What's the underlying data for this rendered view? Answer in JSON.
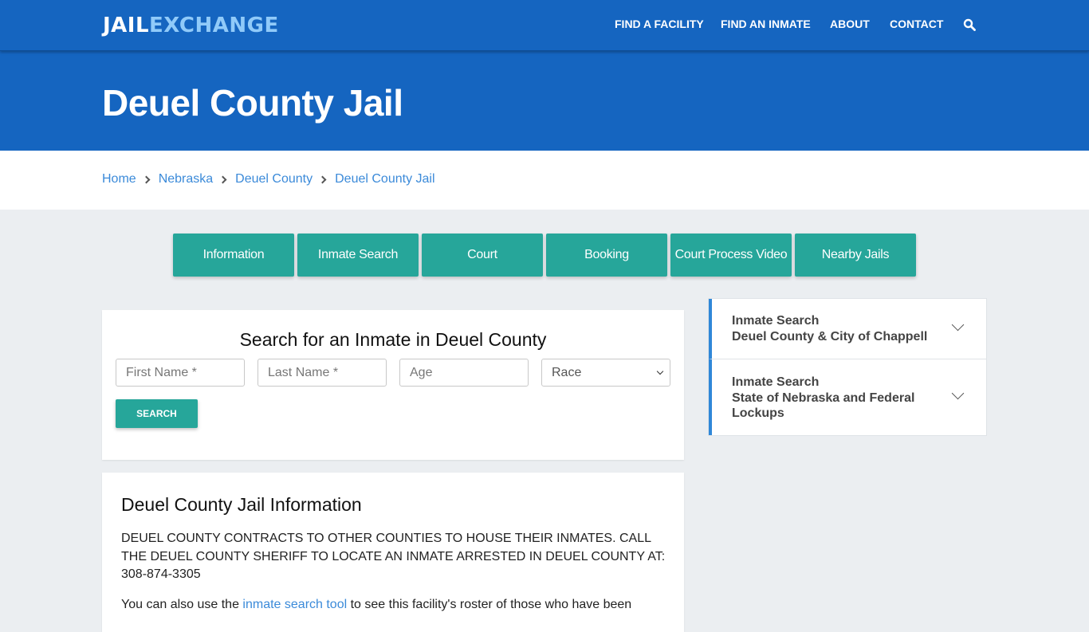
{
  "header": {
    "logo_part1": "JAIL",
    "logo_part2": "EXCHANGE",
    "nav": [
      {
        "label": "FIND A FACILITY"
      },
      {
        "label": "FIND AN INMATE"
      },
      {
        "label": "ABOUT"
      },
      {
        "label": "CONTACT"
      }
    ],
    "search_icon": "search-icon"
  },
  "hero": {
    "title": "Deuel County Jail"
  },
  "breadcrumb": [
    {
      "label": "Home"
    },
    {
      "label": "Nebraska"
    },
    {
      "label": "Deuel County"
    },
    {
      "label": "Deuel County Jail"
    }
  ],
  "tabs": [
    {
      "label": "Information"
    },
    {
      "label": "Inmate Search"
    },
    {
      "label": "Court"
    },
    {
      "label": "Booking"
    },
    {
      "label": "Court Process Video"
    },
    {
      "label": "Nearby Jails"
    }
  ],
  "search_form": {
    "title": "Search for an Inmate in Deuel County",
    "first_name_placeholder": "First Name *",
    "last_name_placeholder": "Last Name *",
    "age_placeholder": "Age",
    "race_selected": "Race",
    "submit_label": "SEARCH"
  },
  "info": {
    "title": "Deuel County Jail Information",
    "paragraph1": "DEUEL COUNTY CONTRACTS TO OTHER COUNTIES TO HOUSE THEIR INMATES.  CALL THE DEUEL COUNTY SHERIFF TO LOCATE AN INMATE ARRESTED IN DEUEL COUNTY AT: 308-874-3305",
    "paragraph2_before": "You can also use the ",
    "paragraph2_link": "inmate search tool",
    "paragraph2_after": " to see this facility's roster of those who have been"
  },
  "sidebar": {
    "items": [
      {
        "line1": "Inmate Search",
        "line2": "Deuel County & City of Chappell"
      },
      {
        "line1": "Inmate Search",
        "line2": "State of Nebraska and Federal Lockups"
      }
    ]
  },
  "colors": {
    "brand_blue": "#1565c0",
    "accent_teal": "#26a69a",
    "link_blue": "#3b8ad9",
    "logo_light": "#90caf9"
  }
}
